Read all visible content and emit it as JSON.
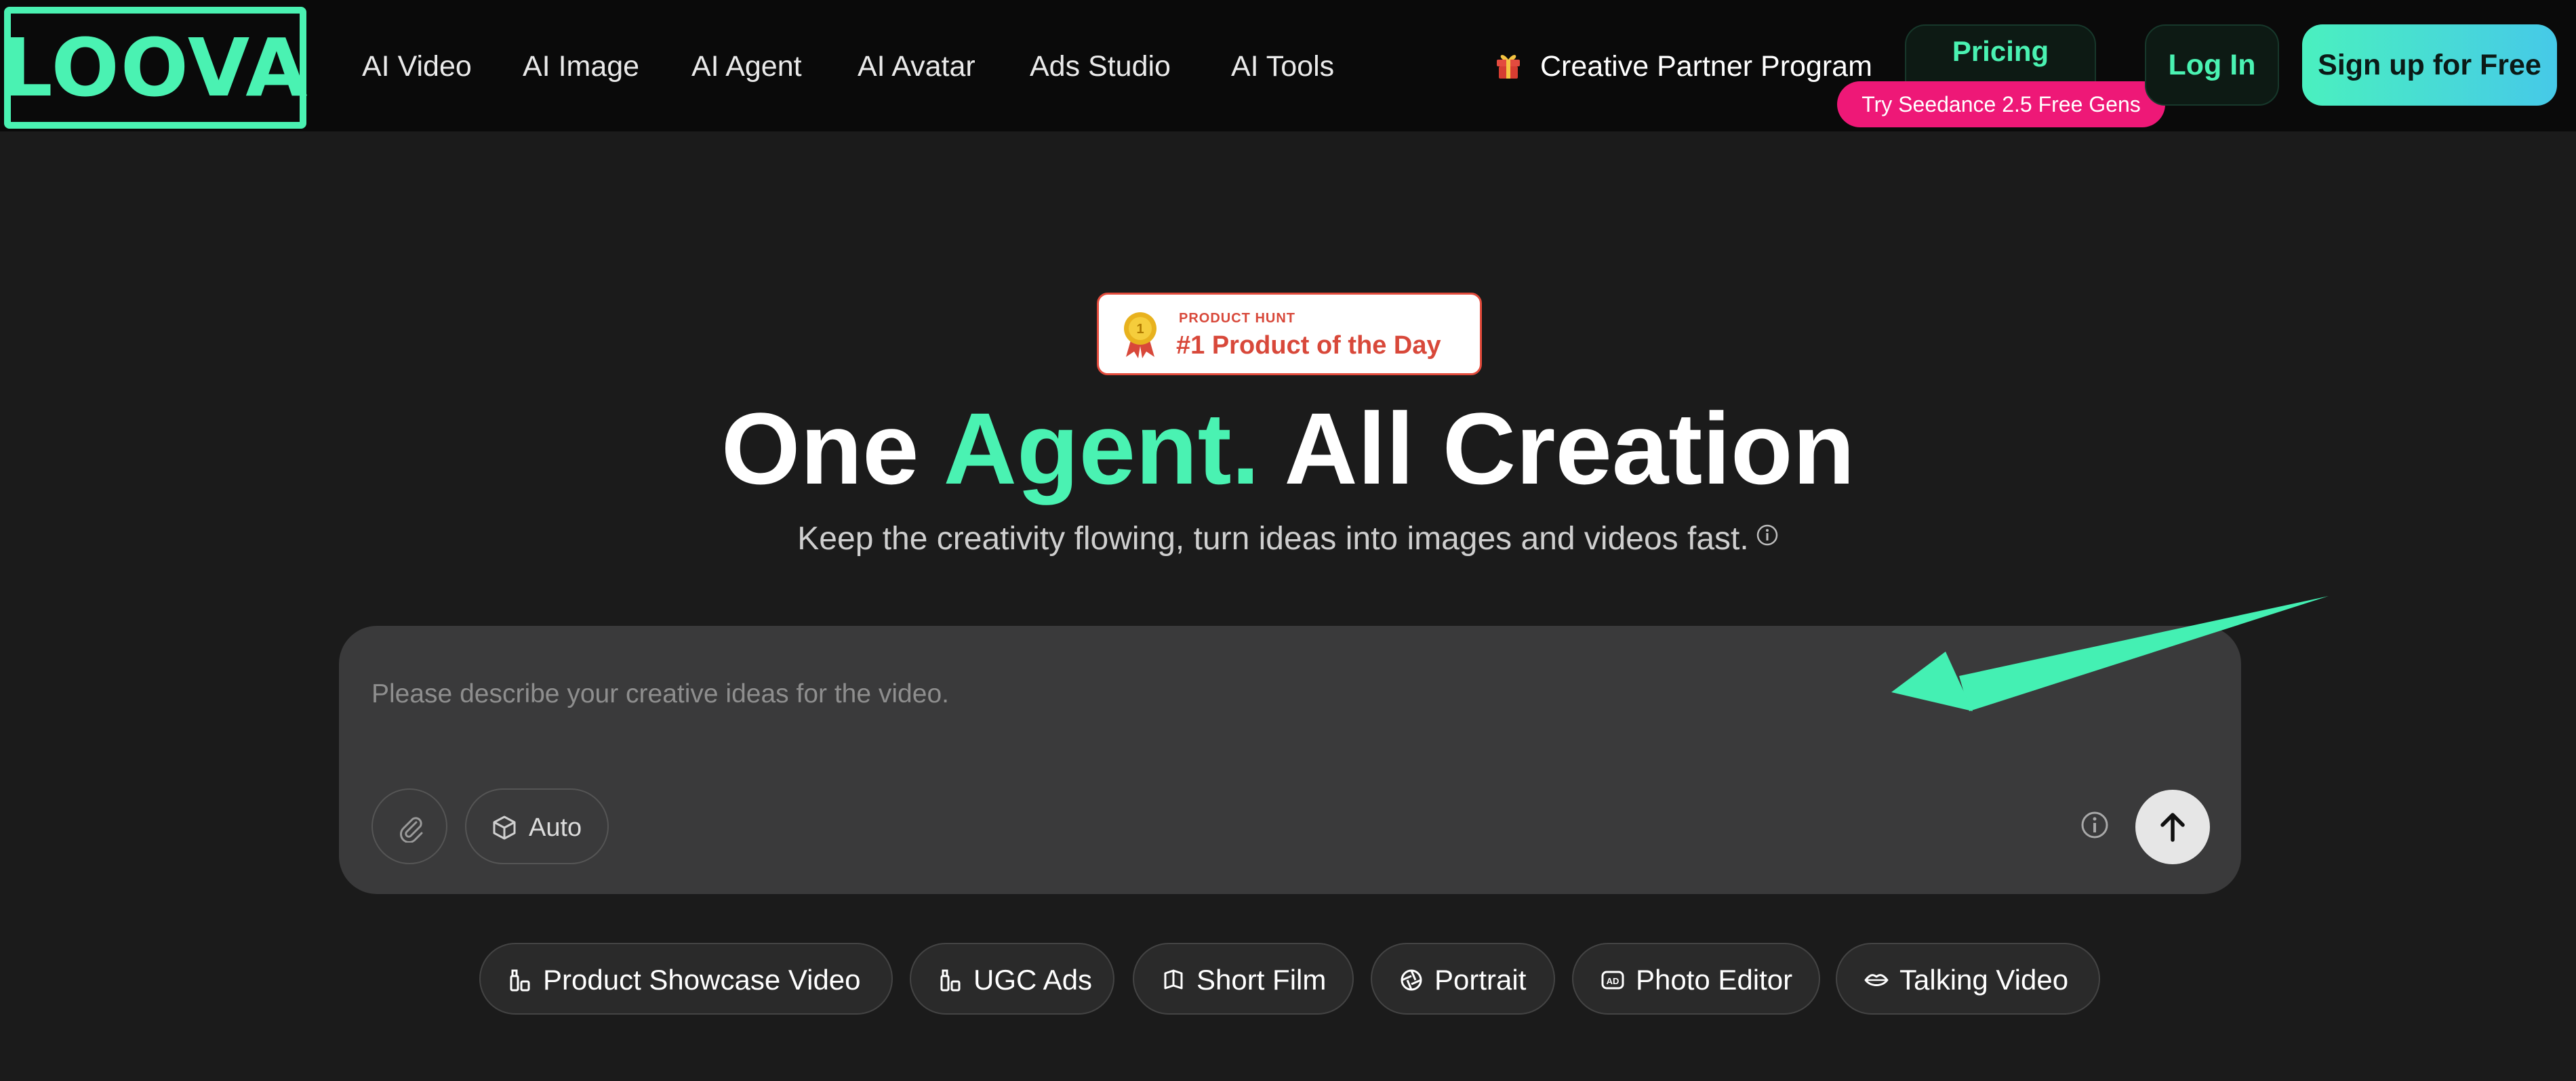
{
  "brand": {
    "logo_text": "LOOVA",
    "accent": "#4af2b2"
  },
  "nav": {
    "items": [
      {
        "label": "AI Video"
      },
      {
        "label": "AI Image"
      },
      {
        "label": "AI Agent"
      },
      {
        "label": "AI Avatar"
      },
      {
        "label": "Ads Studio"
      },
      {
        "label": "AI Tools"
      }
    ],
    "partner_program": "Creative Partner Program",
    "pricing_label": "Pricing",
    "promo_badge": "Try Seedance 2.5 Free Gens",
    "login_label": "Log In",
    "signup_label": "Sign up for Free"
  },
  "product_hunt": {
    "small_label": "PRODUCT HUNT",
    "title": "#1 Product of the Day",
    "color": "#d8483a"
  },
  "hero": {
    "title_part1": "One ",
    "title_accent": "Agent.",
    "title_part2": " All Creation",
    "subtitle": "Keep the creativity flowing, turn ideas into images and videos fast."
  },
  "prompt": {
    "placeholder": "Please describe your creative ideas for the video.",
    "value": "",
    "mode_label": "Auto"
  },
  "chips": [
    {
      "label": "Product Showcase Video",
      "icon": "bottles-icon"
    },
    {
      "label": "UGC Ads",
      "icon": "bottles-icon"
    },
    {
      "label": "Short Film",
      "icon": "film-icon"
    },
    {
      "label": "Portrait",
      "icon": "aperture-icon"
    },
    {
      "label": "Photo Editor",
      "icon": "ad-icon"
    },
    {
      "label": "Talking Video",
      "icon": "lips-icon"
    }
  ],
  "colors": {
    "background": "#1b1b1b",
    "topbar": "#0a0a0a",
    "promo": "#ee1877",
    "prompt_box": "#3a3a3b"
  }
}
